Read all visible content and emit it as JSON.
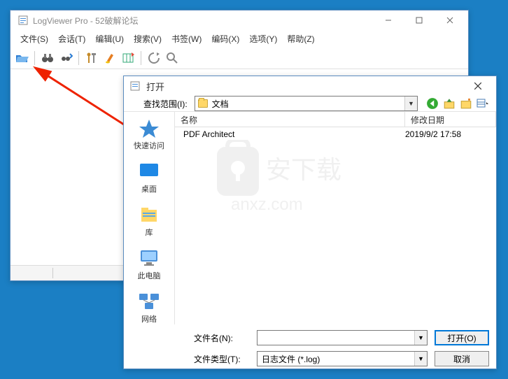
{
  "main": {
    "title": "LogViewer Pro - 52破解论坛",
    "menus": [
      "文件(S)",
      "会话(T)",
      "编辑(U)",
      "搜索(V)",
      "书签(W)",
      "编码(X)",
      "选项(Y)",
      "帮助(Z)"
    ]
  },
  "dialog": {
    "title": "打开",
    "lookin_label": "查找范围(I):",
    "lookin_value": "文档",
    "columns": {
      "name": "名称",
      "date": "修改日期"
    },
    "rows": [
      {
        "name": "PDF Architect",
        "date": "2019/9/2 17:58"
      }
    ],
    "places": {
      "quick": "快速访问",
      "desktop": "桌面",
      "library": "库",
      "thispc": "此电脑",
      "network": "网络"
    },
    "filename_label": "文件名(N):",
    "filename_value": "",
    "filetype_label": "文件类型(T):",
    "filetype_value": "日志文件 (*.log)",
    "open_btn": "打开(O)",
    "cancel_btn": "取消"
  },
  "watermark": {
    "line1": "安下载",
    "line2": "anxz.com"
  }
}
